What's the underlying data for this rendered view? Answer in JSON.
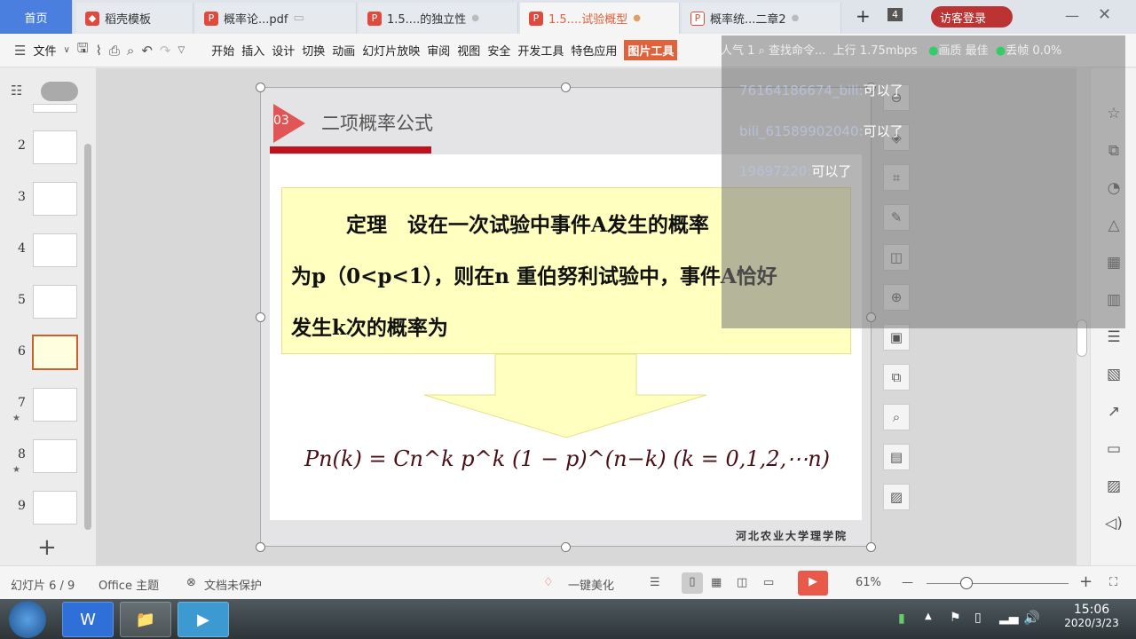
{
  "tabs": [
    {
      "label": "首页"
    },
    {
      "label": "稻壳模板"
    },
    {
      "label": "概率论...pdf"
    },
    {
      "label": "1.5....的独立性"
    },
    {
      "label": "1.5....试验概型"
    },
    {
      "label": "概率统...二章2"
    }
  ],
  "tab_count": "4",
  "login_label": "访客登录",
  "toolbar": {
    "file": "文件",
    "menus": [
      "开始",
      "插入",
      "设计",
      "切换",
      "动画",
      "幻灯片放映",
      "审阅",
      "视图",
      "安全",
      "开发工具",
      "特色应用"
    ],
    "picture_tools": "图片工具",
    "search": "查找命令..."
  },
  "stream": {
    "popularity": "人气 1",
    "upload": "上行",
    "rate": "1.75mbps",
    "quality_label": "画质",
    "quality": "最佳",
    "drop_label": "丢帧",
    "drop": "0.0%"
  },
  "danmu": [
    {
      "user": "76164186674_bili:",
      "msg": "可以了"
    },
    {
      "user": "bili_61589902040:",
      "msg": "可以了"
    },
    {
      "user": "19697220:",
      "msg": "可以了"
    }
  ],
  "thumbs": [
    "2",
    "3",
    "4",
    "5",
    "6",
    "7",
    "8",
    "9"
  ],
  "slide": {
    "number": "03",
    "title": "二项概率公式",
    "line1": "定理　设在一次试验中事件A发生的概率",
    "line2": "为p（0<p<1），则在n 重伯努利试验中，事件A恰好",
    "line3": "发生k次的概率为",
    "formula": "Pn(k) = Cn^k p^k (1 − p)^(n−k)    (k = 0,1,2,⋯n)",
    "footer": "河北农业大学理学院"
  },
  "status": {
    "slide": "幻灯片 6 / 9",
    "theme": "Office 主题",
    "protect": "文档未保护",
    "beautify": "一键美化",
    "zoom": "61%",
    "zoom_percent": 61
  },
  "clock": {
    "time": "15:06",
    "date": "2020/3/23"
  },
  "colors": {
    "accent": "#e0623a",
    "home_tab": "#4a7fe0",
    "slide_red": "#c0111f",
    "yellow": "#ffffc0"
  }
}
